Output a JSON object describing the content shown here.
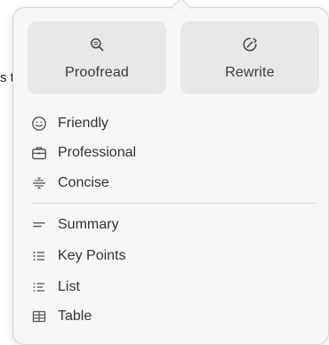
{
  "background_text": "s t",
  "menu": {
    "top_buttons": [
      {
        "label": "Proofread",
        "icon": "magnifier-icon"
      },
      {
        "label": "Rewrite",
        "icon": "rewrite-circle-icon"
      }
    ],
    "tone_items": [
      {
        "label": "Friendly",
        "icon": "smiley-icon"
      },
      {
        "label": "Professional",
        "icon": "briefcase-icon"
      },
      {
        "label": "Concise",
        "icon": "divide-icon"
      }
    ],
    "format_items": [
      {
        "label": "Summary",
        "icon": "summary-lines-icon"
      },
      {
        "label": "Key Points",
        "icon": "bullet-list-icon"
      },
      {
        "label": "List",
        "icon": "numbered-list-icon"
      },
      {
        "label": "Table",
        "icon": "table-icon"
      }
    ]
  },
  "colors": {
    "panel": "#f7f7f7",
    "button": "#e8e8e8",
    "text": "#333333",
    "icon": "#555555"
  }
}
